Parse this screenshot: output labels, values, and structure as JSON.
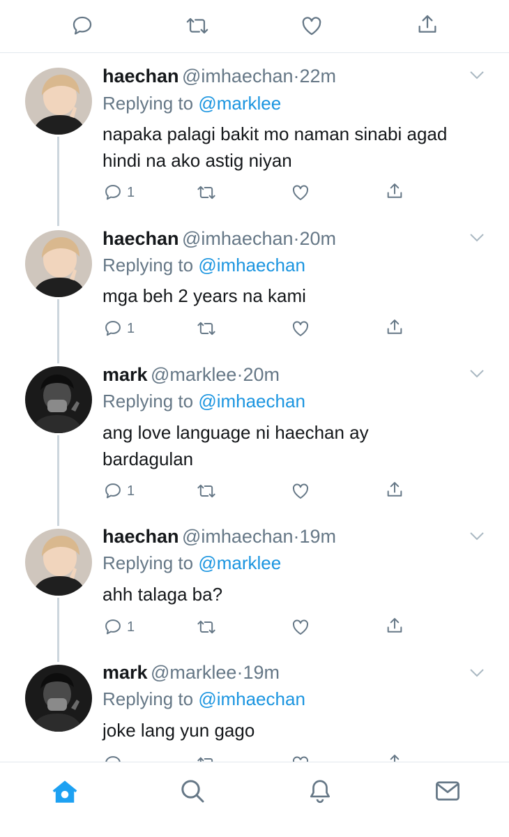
{
  "top_actions": {
    "icons": [
      "reply-icon",
      "retweet-icon",
      "like-icon",
      "share-icon"
    ],
    "color": "#657786"
  },
  "tweets": [
    {
      "name": "haechan",
      "handle": "@imhaechan",
      "time": "22m",
      "sep": "·",
      "replying_label": "Replying to",
      "replying_to": "@marklee",
      "text_lines": [
        "napaka palagi bakit mo naman sinabi agad",
        "hindi na ako astig niyan"
      ],
      "reply_count": "1",
      "avatar": "light-hair-avatar"
    },
    {
      "name": "haechan",
      "handle": "@imhaechan",
      "time": "20m",
      "sep": "·",
      "replying_label": "Replying to",
      "replying_to": "@imhaechan",
      "text_lines": [
        "mga beh 2 years na kami"
      ],
      "reply_count": "1",
      "avatar": "light-hair-avatar"
    },
    {
      "name": "mark",
      "handle": "@marklee",
      "time": "20m",
      "sep": "·",
      "replying_label": "Replying to",
      "replying_to": "@imhaechan",
      "text_lines": [
        "ang love language ni haechan ay",
        "bardagulan"
      ],
      "reply_count": "1",
      "avatar": "dark-avatar"
    },
    {
      "name": "haechan",
      "handle": "@imhaechan",
      "time": "19m",
      "sep": "·",
      "replying_label": "Replying to",
      "replying_to": "@marklee",
      "text_lines": [
        "ahh talaga ba?"
      ],
      "reply_count": "1",
      "avatar": "light-hair-avatar"
    },
    {
      "name": "mark",
      "handle": "@marklee",
      "time": "19m",
      "sep": "·",
      "replying_label": "Replying to",
      "replying_to": "@imhaechan",
      "text_lines": [
        "joke lang yun gago"
      ],
      "reply_count": "",
      "avatar": "dark-avatar"
    }
  ],
  "bottom_nav": {
    "items": [
      "home-icon",
      "search-icon",
      "notifications-icon",
      "messages-icon"
    ],
    "active": "home-icon",
    "active_color": "#1da1f2"
  },
  "colors": {
    "link": "#1b95e0",
    "secondary": "#657786",
    "divider": "#e1e8ed"
  }
}
